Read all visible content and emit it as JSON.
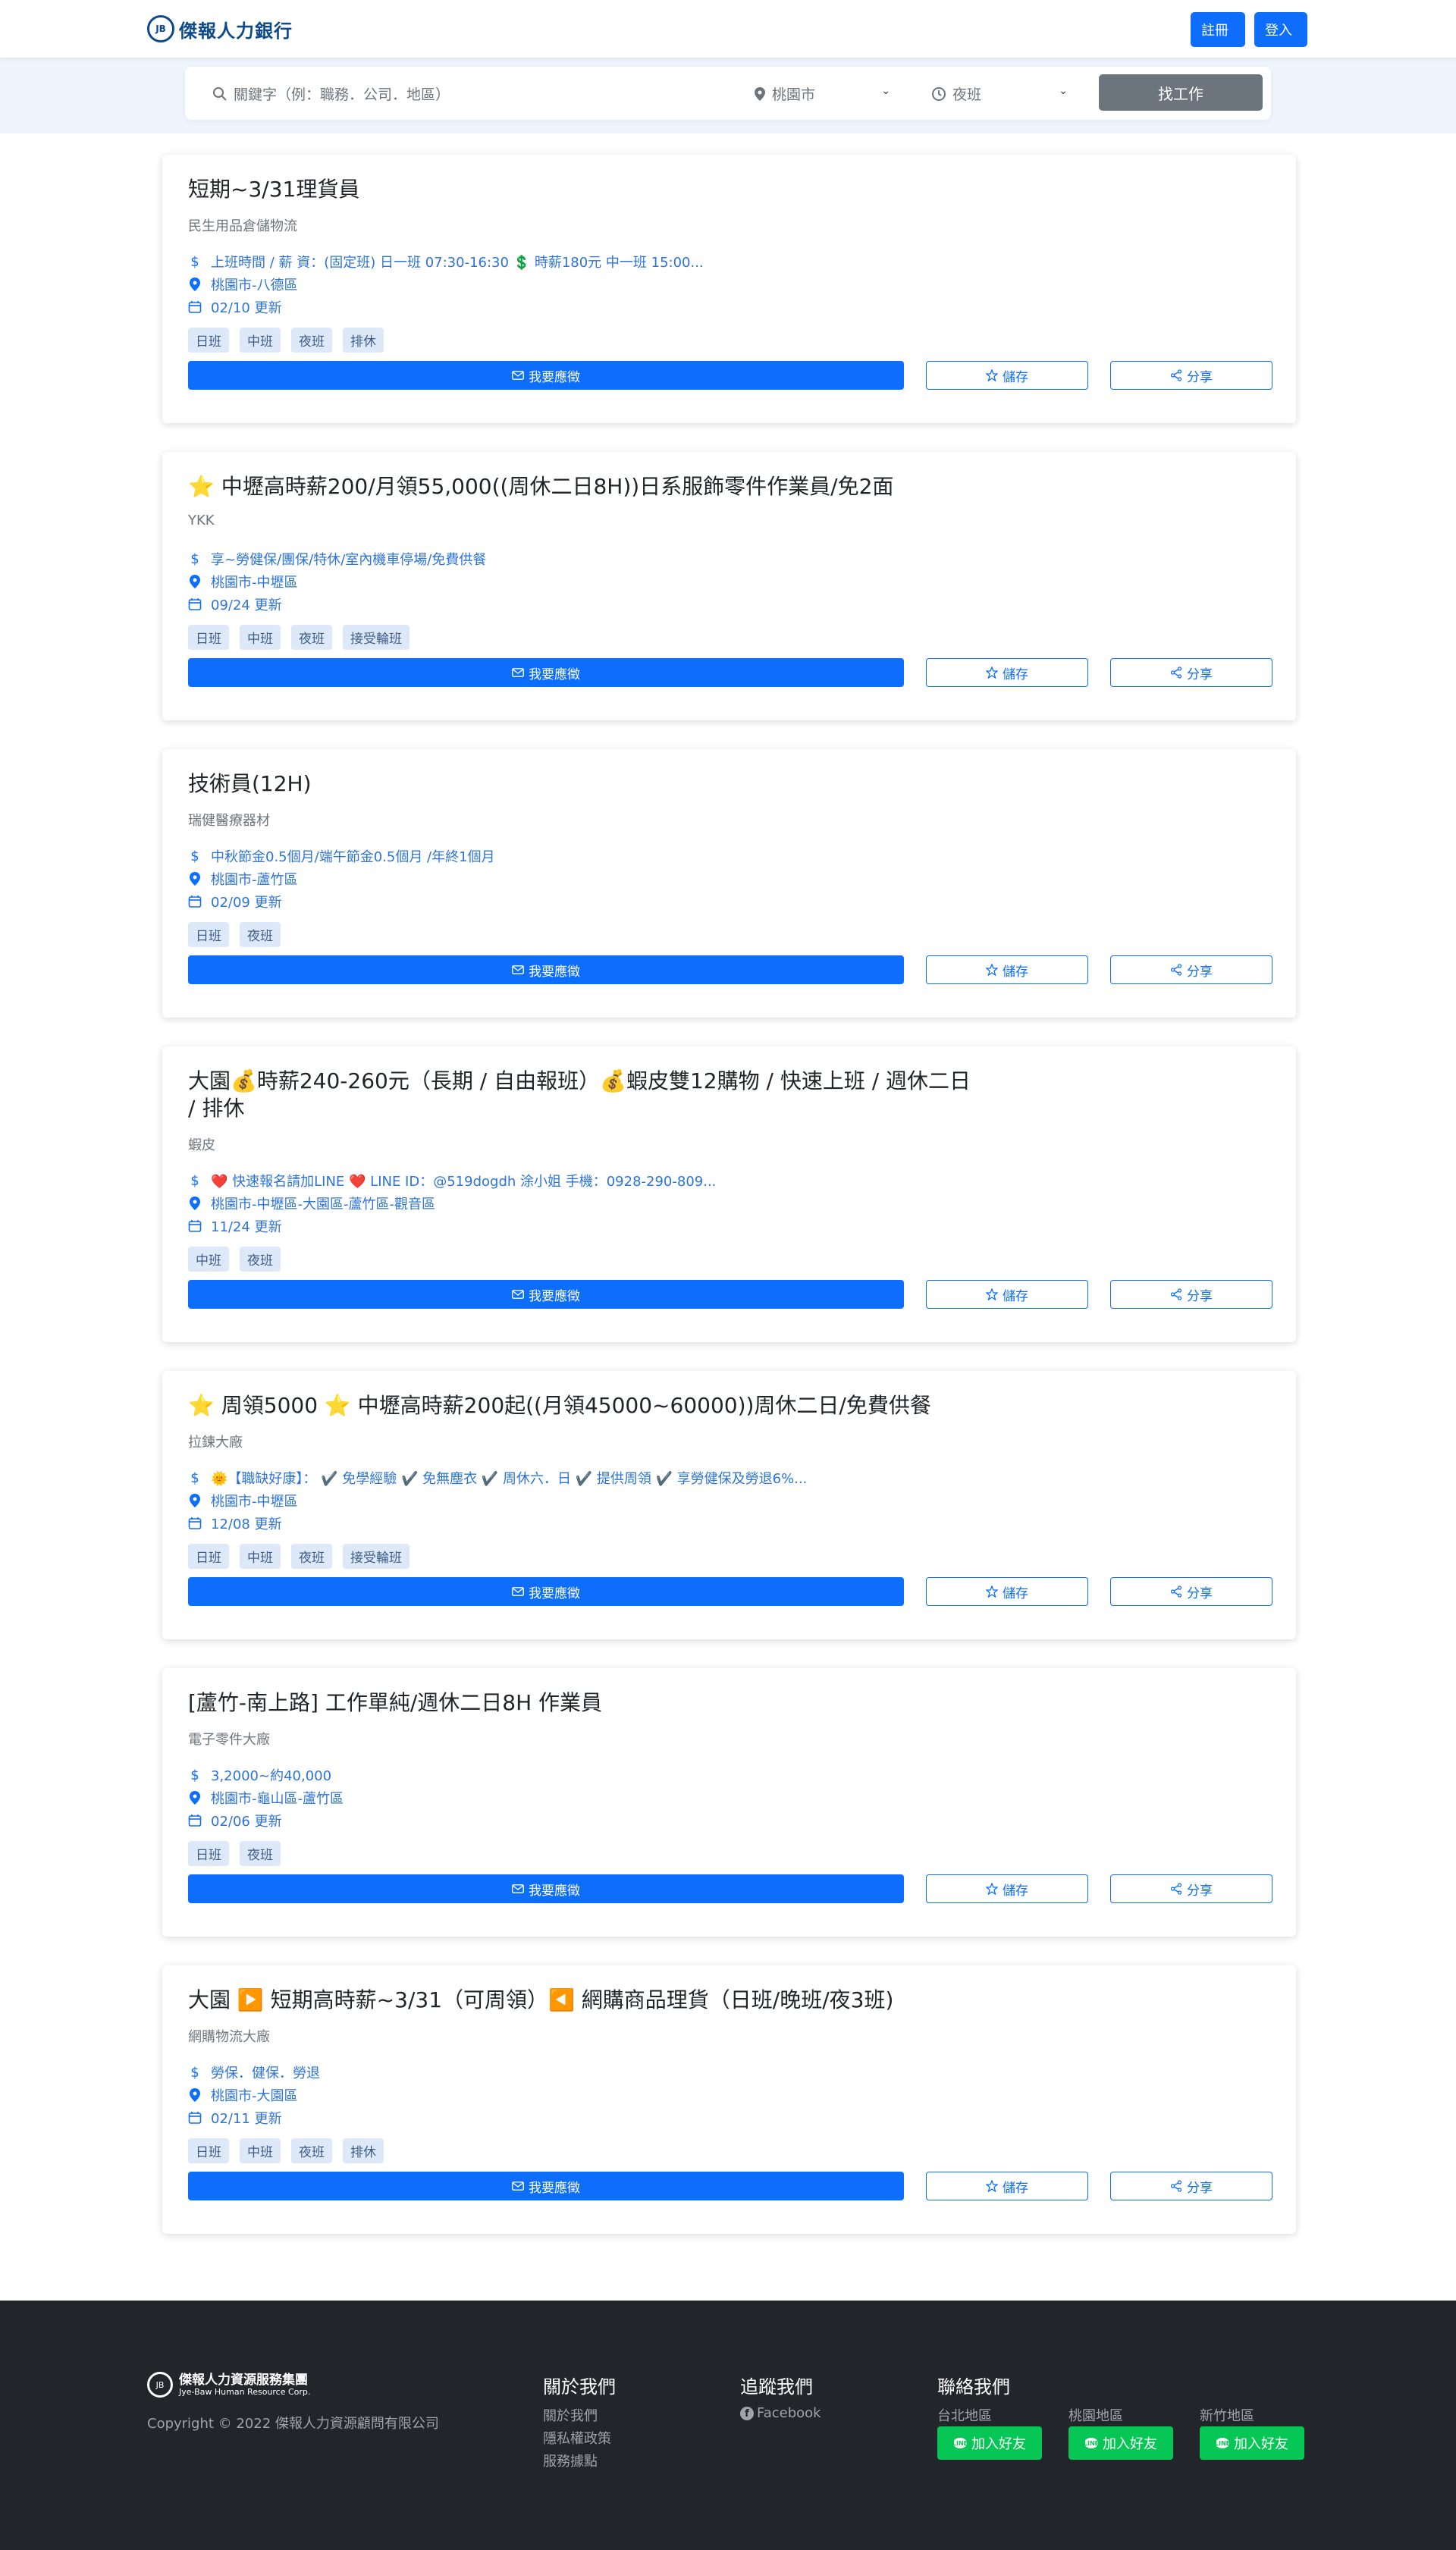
{
  "header": {
    "brand": "傑報人力銀行",
    "register_label": "註冊",
    "login_label": "登入"
  },
  "search": {
    "keyword_placeholder": "關鍵字（例：職務．公司．地區）",
    "location_value": "桃園市",
    "shift_value": "夜班",
    "find_label": "找工作"
  },
  "buttons": {
    "apply": "我要應徵",
    "save": "儲存",
    "share": "分享"
  },
  "jobs": [
    {
      "title": "短期~3/31理貨員",
      "company": "民生用品倉儲物流",
      "salary": "上班時間 / 薪 資：(固定班) 日一班 07:30-16:30 💲 時薪180元 中一班 15:00...",
      "location": "桃園市-八德區",
      "updated": "02/10 更新",
      "tags": [
        "日班",
        "中班",
        "夜班",
        "排休"
      ]
    },
    {
      "title": "⭐ 中壢高時薪200/月領55,000((周休二日8H))日系服飾零件作業員/免2面",
      "company": "YKK",
      "salary": "享~勞健保/團保/特休/室內機車停場/免費供餐",
      "location": "桃園市-中壢區",
      "updated": "09/24 更新",
      "tags": [
        "日班",
        "中班",
        "夜班",
        "接受輪班"
      ]
    },
    {
      "title": "技術員(12H)",
      "company": "瑞健醫療器材",
      "salary": "中秋節金0.5個月/端午節金0.5個月 /年終1個月",
      "location": "桃園市-蘆竹區",
      "updated": "02/09 更新",
      "tags": [
        "日班",
        "夜班"
      ]
    },
    {
      "title": "大園💰時薪240-260元（長期 / 自由報班）💰蝦皮雙12購物 / 快速上班 / 週休二日 / 排休",
      "company": "蝦皮",
      "salary": "❤️ 快速報名請加LINE ❤️ LINE ID：@519dogdh 涂小姐 手機：0928-290-809...",
      "location": "桃園市-中壢區-大園區-蘆竹區-觀音區",
      "updated": "11/24 更新",
      "tags": [
        "中班",
        "夜班"
      ]
    },
    {
      "title": "⭐ 周領5000 ⭐ 中壢高時薪200起((月領45000~60000))周休二日/免費供餐",
      "company": "拉鍊大廠",
      "salary": "🌞【職缺好康】： ✔️ 免學經驗 ✔️ 免無塵衣 ✔️ 周休六．日 ✔️ 提供周領 ✔️ 享勞健保及勞退6%...",
      "location": "桃園市-中壢區",
      "updated": "12/08 更新",
      "tags": [
        "日班",
        "中班",
        "夜班",
        "接受輪班"
      ]
    },
    {
      "title": "[蘆竹-南上路] 工作單純/週休二日8H 作業員",
      "company": "電子零件大廠",
      "salary": "3,2000~約40,000",
      "location": "桃園市-龜山區-蘆竹區",
      "updated": "02/06 更新",
      "tags": [
        "日班",
        "夜班"
      ]
    },
    {
      "title": "大園 ▶️ 短期高時薪~3/31（可周領）◀️ 網購商品理貨（日班/晚班/夜3班)",
      "company": "網購物流大廠",
      "salary": "勞保．健保．勞退",
      "location": "桃園市-大園區",
      "updated": "02/11 更新",
      "tags": [
        "日班",
        "中班",
        "夜班",
        "排休"
      ]
    }
  ],
  "footer": {
    "logo_text": "傑報人力資源服務集團",
    "logo_sub": "Jye-Baw Human Resource Corp.",
    "copyright": "Copyright © 2022 傑報人力資源顧問有限公司",
    "about_heading": "關於我們",
    "about_links": [
      "關於我們",
      "隱私權政策",
      "服務據點"
    ],
    "follow_heading": "追蹤我們",
    "facebook_label": "Facebook",
    "contact_heading": "聯絡我們",
    "regions": [
      "台北地區",
      "桃園地區",
      "新竹地區"
    ],
    "line_label": "加入好友"
  },
  "colors": {
    "primary": "#0d6efd",
    "footer_bg": "#22252a",
    "line_green": "#06c755",
    "brand_blue": "#0d4a8a"
  }
}
